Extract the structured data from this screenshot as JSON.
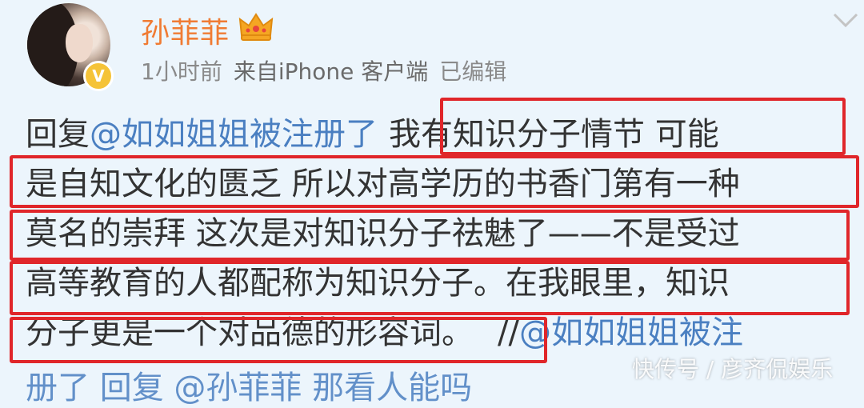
{
  "post": {
    "username": "孙菲菲",
    "time": "1小时前",
    "source": "来自iPhone 客户端",
    "edited": "已编辑",
    "reply_prefix": "回复",
    "reply_mention": "@如如姐姐被注册了",
    "line1_text": "我有知识分子情节  可能",
    "line2_text": "是自知文化的匮乏 所以对高学历的书香门第有一种",
    "line3_text": "莫名的崇拜 这次是对知识分子祛魅了——不是受过",
    "line4_text": "高等教育的人都配称为知识分子。在我眼里，知识",
    "line5_text": "分子更是一个对品德的形容词。",
    "line5_sep": "//",
    "line5_mention": "@如如姐姐被注",
    "line6_partial": "册了 回复 @孙菲菲 那看人能吗"
  },
  "watermark": "快传号 / 彦齐侃娱乐",
  "icons": {
    "verified": "verified-badge-icon",
    "crown": "crown-icon",
    "menu": "chevron-down-icon"
  },
  "colors": {
    "username": "#f07b33",
    "mention": "#4a7fc1",
    "highlight": "#e0262a",
    "background": "#ecf5fc"
  }
}
